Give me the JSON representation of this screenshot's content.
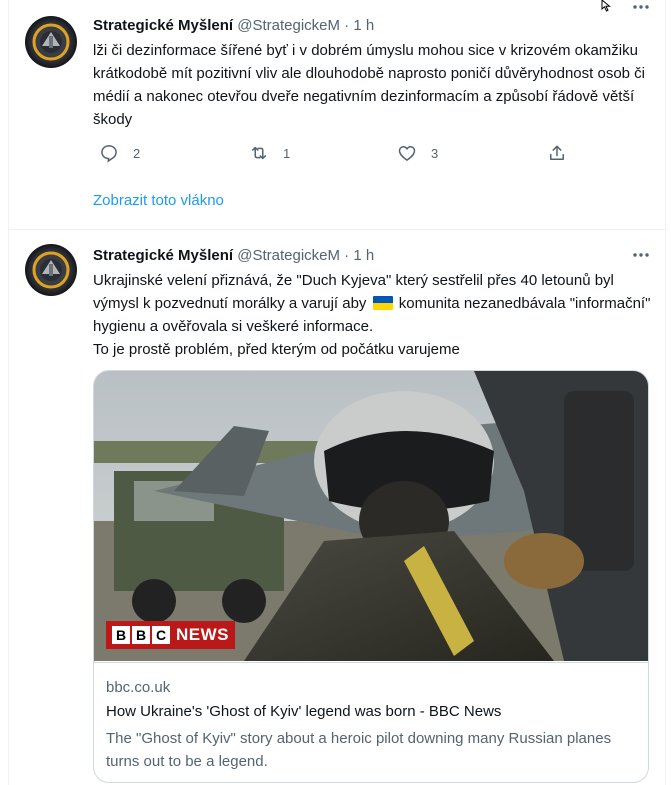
{
  "tweets": [
    {
      "name": "Strategické Myšlení",
      "handle": "@StrategickeM",
      "separator": "·",
      "time": "1 h",
      "text": "lži či dezinformace šířené byť i v dobrém úmyslu mohou sice v krizovém okamžiku krátkodobě mít pozitivní vliv ale dlouhodobě naprosto poničí důvěryhodnost osob či médií a nakonec otevřou dveře negativním dezinformacím a způsobí řádově větší škody",
      "reply_count": "2",
      "retweet_count": "1",
      "like_count": "3",
      "show_thread": "Zobrazit toto vlákno"
    },
    {
      "name": "Strategické Myšlení",
      "handle": "@StrategickeM",
      "separator": "·",
      "time": "1 h",
      "text_part1": "Ukrajinské velení přiznává, že \"Duch Kyjeva\" který sestřelil přes 40 letounů byl výmysl k pozvednutí morálky a varují aby",
      "flag_icon": "ukraine-flag",
      "text_part2": "komunita nezanedbávala \"informační\" hygienu a ověřovala si veškeré informace.",
      "text_part3": "To je prostě problém, před kterým od počátku varujeme",
      "card": {
        "domain": "bbc.co.uk",
        "title": "How Ukraine's 'Ghost of Kyiv' legend was born - BBC News",
        "description": "The \"Ghost of Kyiv\" story about a heroic pilot downing many Russian planes turns out to be a legend.",
        "logo_letters": [
          "B",
          "B",
          "C"
        ],
        "logo_word": "NEWS"
      }
    }
  ],
  "colors": {
    "accent": "#1d9bf0",
    "secondary_text": "#536471",
    "bbc_red": "#bb1919",
    "border": "#eff3f4"
  }
}
